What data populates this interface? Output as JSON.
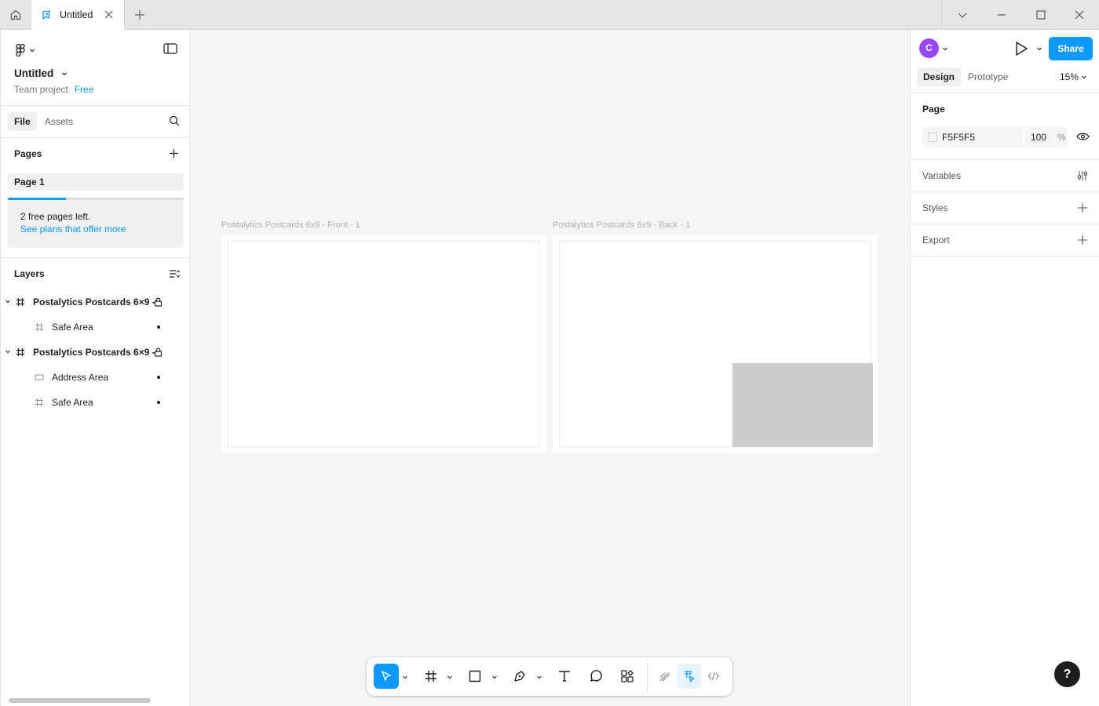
{
  "titlebar": {
    "tab_title": "Untitled"
  },
  "left_panel": {
    "file_name": "Untitled",
    "team_label": "Team project",
    "plan_badge": "Free",
    "tabs": {
      "file": "File",
      "assets": "Assets"
    },
    "pages_title": "Pages",
    "pages": [
      "Page 1"
    ],
    "promo": {
      "text": "2 free pages left.",
      "link": "See plans that offer more",
      "progress_fraction": 0.33
    },
    "layers_title": "Layers",
    "layers": [
      {
        "name": "Postalytics Postcards 6×9 -",
        "type": "frame",
        "locked": true,
        "level": 0
      },
      {
        "name": "Safe Area",
        "type": "frame",
        "level": 1
      },
      {
        "name": "Postalytics Postcards 6×9 -",
        "type": "frame",
        "locked": true,
        "level": 0
      },
      {
        "name": "Address Area",
        "type": "rectangle",
        "level": 1
      },
      {
        "name": "Safe Area",
        "type": "frame",
        "level": 1
      }
    ]
  },
  "canvas": {
    "background": "#F5F5F5",
    "frames": [
      {
        "label": "Postalytics Postcards 6x9 - Front - 1"
      },
      {
        "label": "Postalytics Postcards 6x9 - Back - 1"
      }
    ]
  },
  "toolbar": {
    "tools": [
      "move-icon",
      "frame-icon",
      "rectangle-icon",
      "pen-icon",
      "text-icon",
      "comment-icon",
      "actions-icon"
    ],
    "modes": [
      "draw-mode-icon",
      "design-mode-icon",
      "dev-mode-icon"
    ],
    "accent": "#0D99FF"
  },
  "right_panel": {
    "avatar_letter": "C",
    "avatar_color": "#9747FF",
    "share_label": "Share",
    "tabs": {
      "design": "Design",
      "prototype": "Prototype"
    },
    "zoom": "15%",
    "page_section_title": "Page",
    "page_fill": {
      "hex": "F5F5F5",
      "opacity": "100",
      "unit": "%"
    },
    "variables_title": "Variables",
    "styles_title": "Styles",
    "export_title": "Export",
    "help_label": "?"
  }
}
